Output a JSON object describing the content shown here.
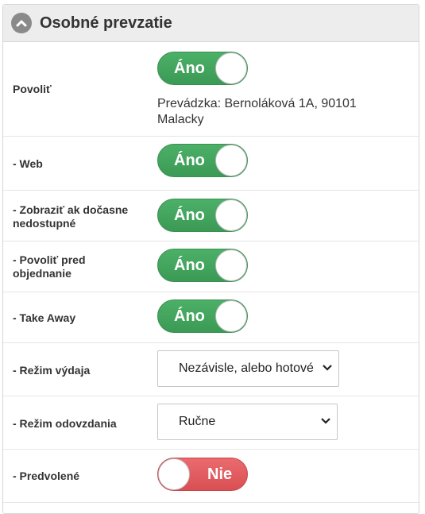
{
  "header": {
    "title": "Osobné prevzatie",
    "collapse_icon": "chevron-up-icon"
  },
  "rows": {
    "povolit": {
      "label": "Povoliť",
      "toggle": "Áno",
      "address": "Prevádzka: Bernoláková 1A, 90101 Malacky"
    },
    "web": {
      "label": "- Web",
      "toggle": "Áno"
    },
    "zobrazit": {
      "label": "- Zobraziť ak dočasne nedostupné",
      "toggle": "Áno"
    },
    "povolit_pred": {
      "label": "- Povoliť pred objednanie",
      "toggle": "Áno"
    },
    "take_away": {
      "label": "- Take Away",
      "toggle": "Áno"
    },
    "rezim_vydaja": {
      "label": "- Režim výdaja",
      "value": "Nezávisle, alebo hotové"
    },
    "rezim_odovzdania": {
      "label": "- Režim odovzdania",
      "value": "Ručne"
    },
    "predvolene": {
      "label": "- Predvolené",
      "toggle": "Nie"
    }
  },
  "colors": {
    "on": "#43a75e",
    "off": "#e05c60",
    "header_bg": "#ededed"
  }
}
